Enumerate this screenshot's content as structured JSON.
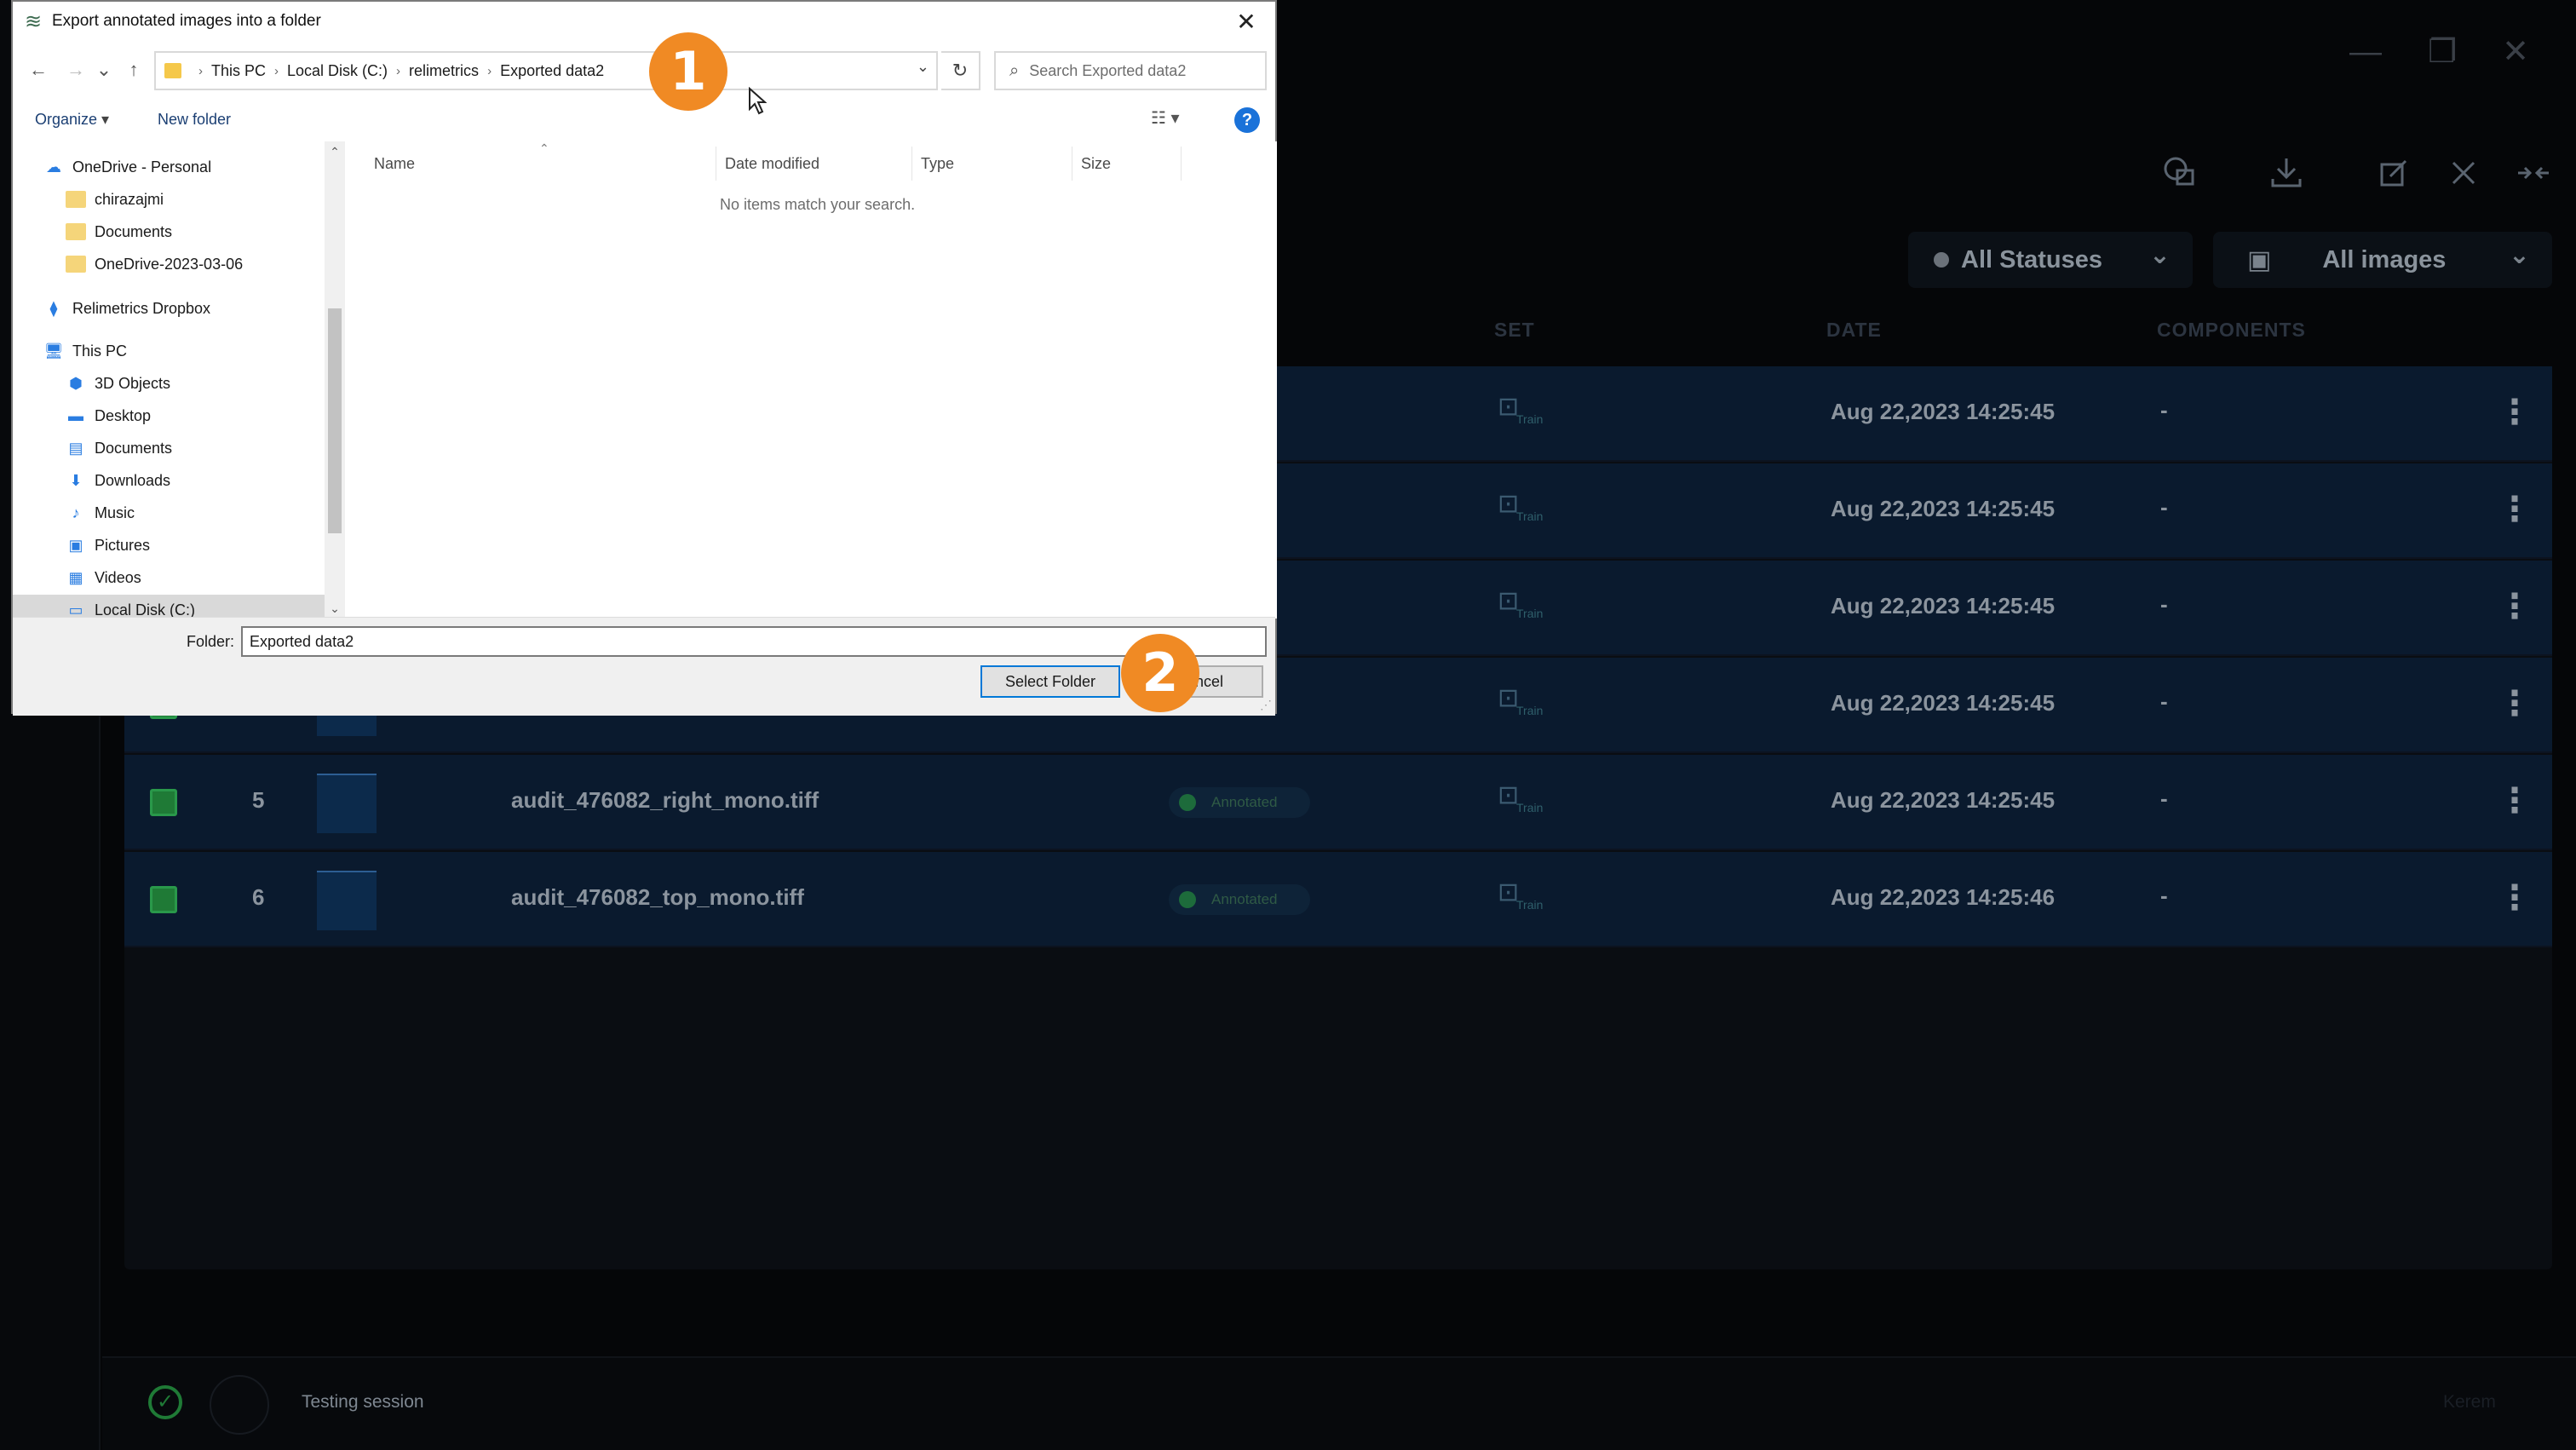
{
  "app": {
    "window_controls": {
      "minimize": "—",
      "maximize": "❐",
      "close": "✕"
    },
    "toolbar_icons": [
      "chat-copy-icon",
      "download-icon",
      "edit-icon",
      "fullscreen-icon",
      "collapse-icon"
    ],
    "filters": {
      "status": "All Statuses",
      "images": "All images"
    },
    "columns": {
      "set": "SET",
      "date": "DATE",
      "components": "COMPONENTS"
    },
    "rows": [
      {
        "num": "",
        "file": "",
        "status": "",
        "set": "Train",
        "date": "Aug 22,2023 14:25:45",
        "components": "-"
      },
      {
        "num": "",
        "file": "",
        "status": "",
        "set": "Train",
        "date": "Aug 22,2023 14:25:45",
        "components": "-"
      },
      {
        "num": "",
        "file": "",
        "status": "",
        "set": "Train",
        "date": "Aug 22,2023 14:25:45",
        "components": "-"
      },
      {
        "num": "",
        "file": "",
        "status": "",
        "set": "Train",
        "date": "Aug 22,2023 14:25:45",
        "components": "-"
      },
      {
        "num": "5",
        "file": "audit_476082_right_mono.tiff",
        "status": "Annotated",
        "set": "Train",
        "date": "Aug 22,2023 14:25:45",
        "components": "-"
      },
      {
        "num": "6",
        "file": "audit_476082_top_mono.tiff",
        "status": "Annotated",
        "set": "Train",
        "date": "Aug 22,2023 14:25:46",
        "components": "-"
      }
    ],
    "footer": {
      "session": "Testing session",
      "user": "Kerem"
    },
    "colors": {
      "accent": "#1f7a36",
      "row_bg": "#0a1a2e",
      "callout": "#f08a24"
    }
  },
  "dialog": {
    "title": "Export annotated images into a folder",
    "close": "✕",
    "nav": {
      "back": "←",
      "forward": "→",
      "recent": "⌄",
      "up": "↑"
    },
    "address": {
      "crumbs": [
        "This PC",
        "Local Disk (C:)",
        "relimetrics",
        "Exported data2"
      ],
      "separator": "›"
    },
    "refresh": "↻",
    "search_placeholder": "Search Exported data2",
    "commands": {
      "organize": "Organize",
      "new_folder": "New folder",
      "help": "?"
    },
    "tree": [
      {
        "label": "OneDrive - Personal",
        "icon": "cloud-icon",
        "glyph": "☁",
        "indent": 0
      },
      {
        "label": "chirazajmi",
        "icon": "folder-icon",
        "glyph": "",
        "indent": 1
      },
      {
        "label": "Documents",
        "icon": "folder-icon",
        "glyph": "",
        "indent": 1
      },
      {
        "label": "OneDrive-2023-03-06",
        "icon": "folder-icon",
        "glyph": "",
        "indent": 1
      },
      {
        "label": "Relimetrics Dropbox",
        "icon": "dropbox-icon",
        "glyph": "⧫",
        "indent": 0
      },
      {
        "label": "This PC",
        "icon": "computer-icon",
        "glyph": "🖥",
        "indent": 0
      },
      {
        "label": "3D Objects",
        "icon": "cube-icon",
        "glyph": "⬢",
        "indent": 1
      },
      {
        "label": "Desktop",
        "icon": "desktop-icon",
        "glyph": "▬",
        "indent": 1
      },
      {
        "label": "Documents",
        "icon": "document-icon",
        "glyph": "▤",
        "indent": 1
      },
      {
        "label": "Downloads",
        "icon": "download-arrow-icon",
        "glyph": "⬇",
        "indent": 1
      },
      {
        "label": "Music",
        "icon": "music-icon",
        "glyph": "♪",
        "indent": 1
      },
      {
        "label": "Pictures",
        "icon": "picture-icon",
        "glyph": "▣",
        "indent": 1
      },
      {
        "label": "Videos",
        "icon": "video-icon",
        "glyph": "▦",
        "indent": 1
      },
      {
        "label": "Local Disk (C:)",
        "icon": "drive-icon",
        "glyph": "▭",
        "indent": 1
      }
    ],
    "file_columns": [
      "Name",
      "Date modified",
      "Type",
      "Size"
    ],
    "empty_message": "No items match your search.",
    "folder_label": "Folder:",
    "folder_value": "Exported data2",
    "buttons": {
      "select": "Select Folder",
      "cancel": "Cancel"
    }
  },
  "callouts": [
    "1",
    "2"
  ]
}
